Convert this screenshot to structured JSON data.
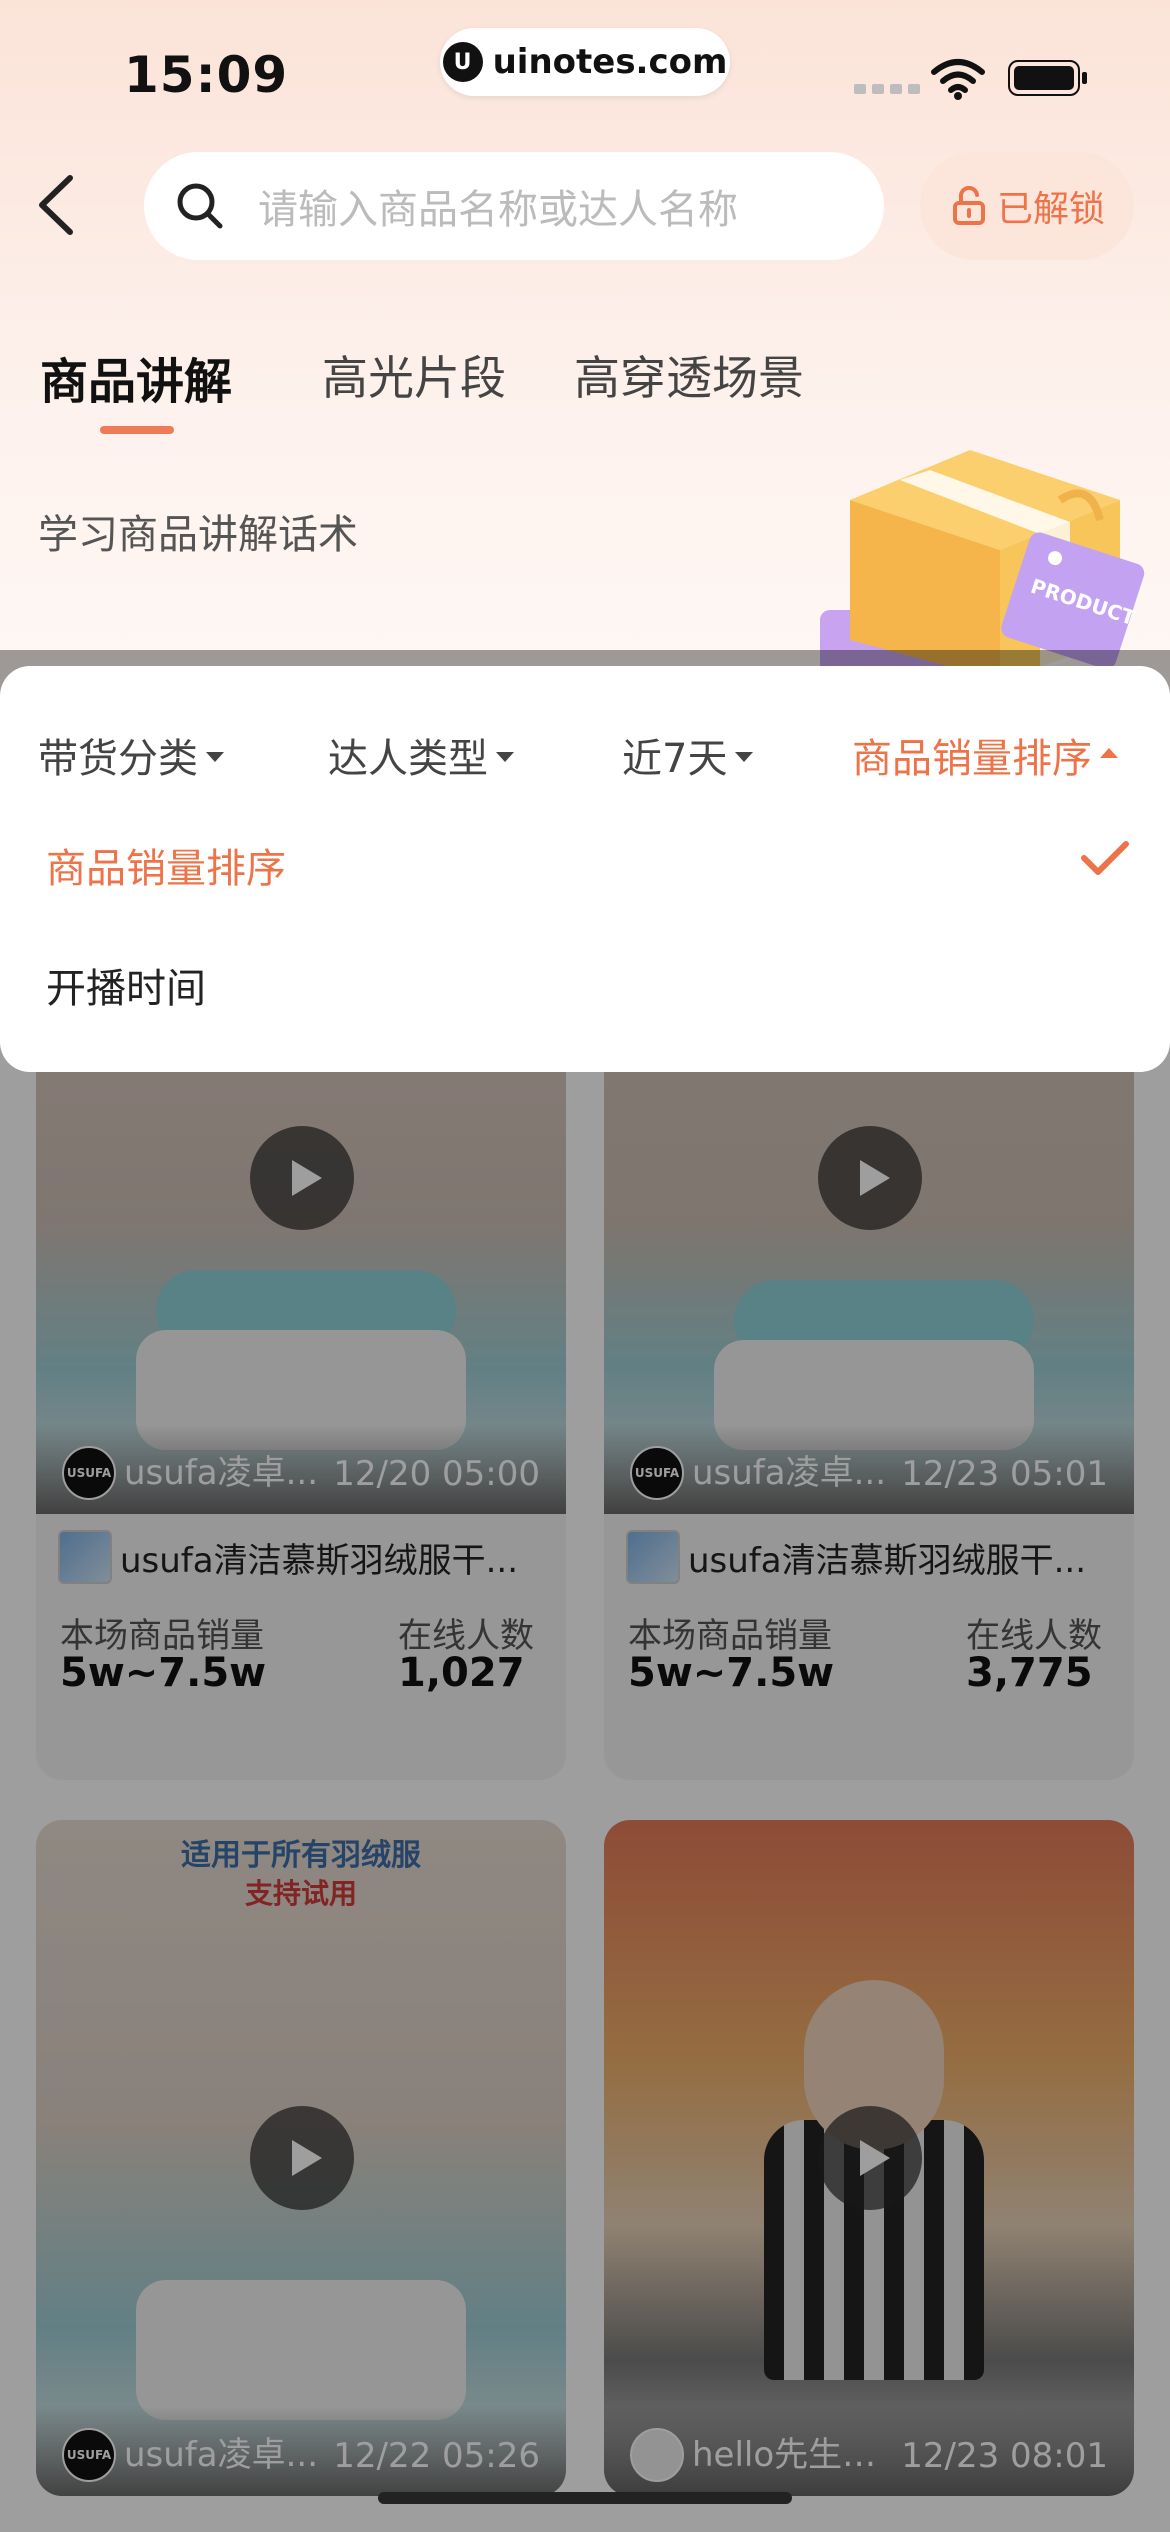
{
  "status_bar": {
    "time": "15:09",
    "url": "uinotes.com"
  },
  "search": {
    "placeholder": "请输入商品名称或达人名称",
    "unlock_label": "已解锁"
  },
  "tabs": [
    {
      "label": "商品讲解",
      "active": true
    },
    {
      "label": "高光片段",
      "active": false
    },
    {
      "label": "高穿透场景",
      "active": false
    }
  ],
  "subtitle": "学习商品讲解话术",
  "illustration_label": "PRODUCT",
  "filters": [
    {
      "label": "带货分类",
      "active": false
    },
    {
      "label": "达人类型",
      "active": false
    },
    {
      "label": "近7天",
      "active": false
    },
    {
      "label": "商品销量排序",
      "active": true
    }
  ],
  "sort_options": [
    {
      "label": "商品销量排序",
      "selected": true
    },
    {
      "label": "开播时间",
      "selected": false
    }
  ],
  "cards": [
    {
      "anchor": "usufa凌卓...",
      "avatar_text": "USUFA",
      "time": "12/20 05:00",
      "product": "usufa清洁慕斯羽绒服干...",
      "sales_label": "本场商品销量",
      "sales": "5w~7.5w",
      "online_label": "在线人数",
      "online": "1,027"
    },
    {
      "anchor": "usufa凌卓...",
      "avatar_text": "USUFA",
      "time": "12/23 05:01",
      "product": "usufa清洁慕斯羽绒服干...",
      "sales_label": "本场商品销量",
      "sales": "5w~7.5w",
      "online_label": "在线人数",
      "online": "3,775"
    },
    {
      "anchor": "usufa凌卓...",
      "avatar_text": "USUFA",
      "time": "12/22 05:26",
      "banner": "适用于所有羽绒服",
      "banner2": "支持试用"
    },
    {
      "anchor": "hello先生🍀...",
      "avatar_text": "",
      "time": "12/23 08:01"
    }
  ],
  "colors": {
    "accent": "#ee7348",
    "background_top": "#fbe3d8"
  }
}
